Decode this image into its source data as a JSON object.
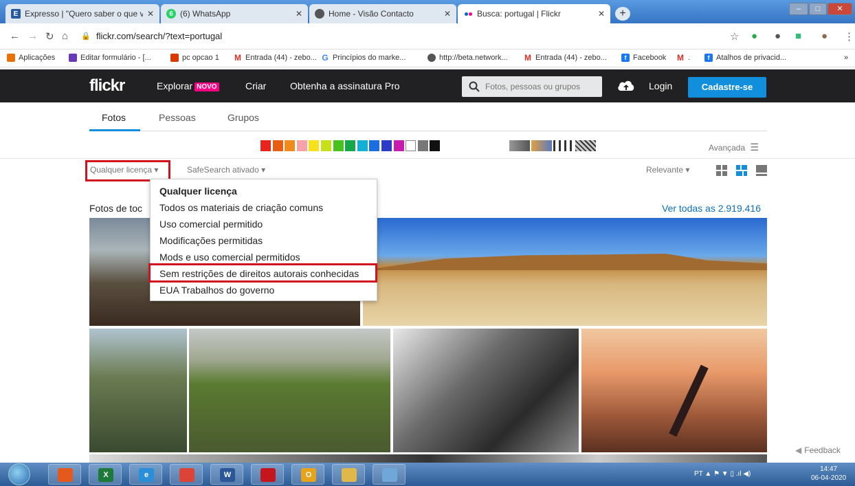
{
  "browser": {
    "tabs": [
      {
        "title": "Expresso | \"Quero saber o que vi",
        "icon": "expresso-icon",
        "color": "#2a5a9e"
      },
      {
        "title": "(6) WhatsApp",
        "icon": "whatsapp-icon",
        "color": "#25d366"
      },
      {
        "title": "Home - Visão Contacto",
        "icon": "globe-icon",
        "color": "#555555"
      },
      {
        "title": "Busca: portugal | Flickr",
        "icon": "flickr-icon",
        "color": "#ff0084"
      }
    ],
    "new_tab": "+",
    "url": "flickr.com/search/?text=portugal",
    "bookmarks": [
      {
        "label": "Aplicações",
        "icon": "apps-icon",
        "color": "#e8710a"
      },
      {
        "label": "Editar formulário - [...",
        "icon": "forms-icon",
        "color": "#673ab7"
      },
      {
        "label": "pc opcao 1",
        "icon": "office-icon",
        "color": "#d83b01"
      },
      {
        "label": "Entrada (44) - zebo...",
        "icon": "gmail-icon",
        "color": "#d93025"
      },
      {
        "label": "Princípios do marke...",
        "icon": "google-icon",
        "color": "#4285f4"
      },
      {
        "label": "http://beta.network...",
        "icon": "globe-icon",
        "color": "#555555"
      },
      {
        "label": "Entrada (44) - zebo...",
        "icon": "gmail-icon",
        "color": "#d93025"
      },
      {
        "label": "Facebook",
        "icon": "facebook-icon",
        "color": "#1877f2"
      },
      {
        "label": ".",
        "icon": "gmail-icon",
        "color": "#d93025"
      },
      {
        "label": "Atalhos de privacid...",
        "icon": "facebook-icon",
        "color": "#1877f2"
      }
    ],
    "bookmarks_more": "»"
  },
  "flickr": {
    "logo": "flickr",
    "nav": {
      "explore": "Explorar",
      "novo_badge": "NOVO",
      "create": "Criar",
      "pro": "Obtenha a assinatura Pro"
    },
    "search_placeholder": "Fotos, pessoas ou grupos",
    "login": "Login",
    "signup": "Cadastre-se",
    "tabs": [
      "Fotos",
      "Pessoas",
      "Grupos"
    ],
    "color_swatches": [
      "#e8241c",
      "#e85d12",
      "#f08a1c",
      "#f5a3a8",
      "#f7e11c",
      "#c8e01a",
      "#48c21c",
      "#14a84a",
      "#12b0d4",
      "#1c6ee0",
      "#2a3cc8",
      "#c81cb0",
      "#ffffff",
      "#777777",
      "#111111"
    ],
    "style_swatches": [
      "grayscale",
      "vintage",
      "pattern",
      "texture"
    ],
    "advanced": "Avançada",
    "filters": {
      "license": "Qualquer licença",
      "safesearch": "SafeSearch ativado",
      "sort": "Relevante"
    },
    "license_menu": [
      "Qualquer licença",
      "Todos os materiais de criação comuns",
      "Uso comercial permitido",
      "Modificações permitidas",
      "Mods e uso comercial permitidos",
      "Sem restrições de direitos autorais conhecidas",
      "EUA Trabalhos do governo"
    ],
    "selected_license_index": 0,
    "highlighted_license_index": 5,
    "section_title": "Fotos de toc",
    "see_all": "Ver todas as 2.919.416",
    "feedback": "Feedback"
  },
  "taskbar": {
    "apps": [
      {
        "name": "media-player-icon",
        "color": "#e35a1c",
        "glyph": ""
      },
      {
        "name": "excel-icon",
        "color": "#1f7a3a",
        "glyph": "X"
      },
      {
        "name": "internet-explorer-icon",
        "color": "#2a8fd8",
        "glyph": "e"
      },
      {
        "name": "chrome-icon",
        "color": "#db4437",
        "glyph": ""
      },
      {
        "name": "word-icon",
        "color": "#2b5797",
        "glyph": "W"
      },
      {
        "name": "acrobat-icon",
        "color": "#c4161c",
        "glyph": ""
      },
      {
        "name": "outlook-icon",
        "color": "#e8a31c",
        "glyph": "O"
      },
      {
        "name": "file-explorer-icon",
        "color": "#e0b84a",
        "glyph": ""
      },
      {
        "name": "paint-icon",
        "color": "#6fa7d8",
        "glyph": ""
      }
    ],
    "lang": "PT",
    "time": "14:47",
    "date": "06-04-2020"
  }
}
